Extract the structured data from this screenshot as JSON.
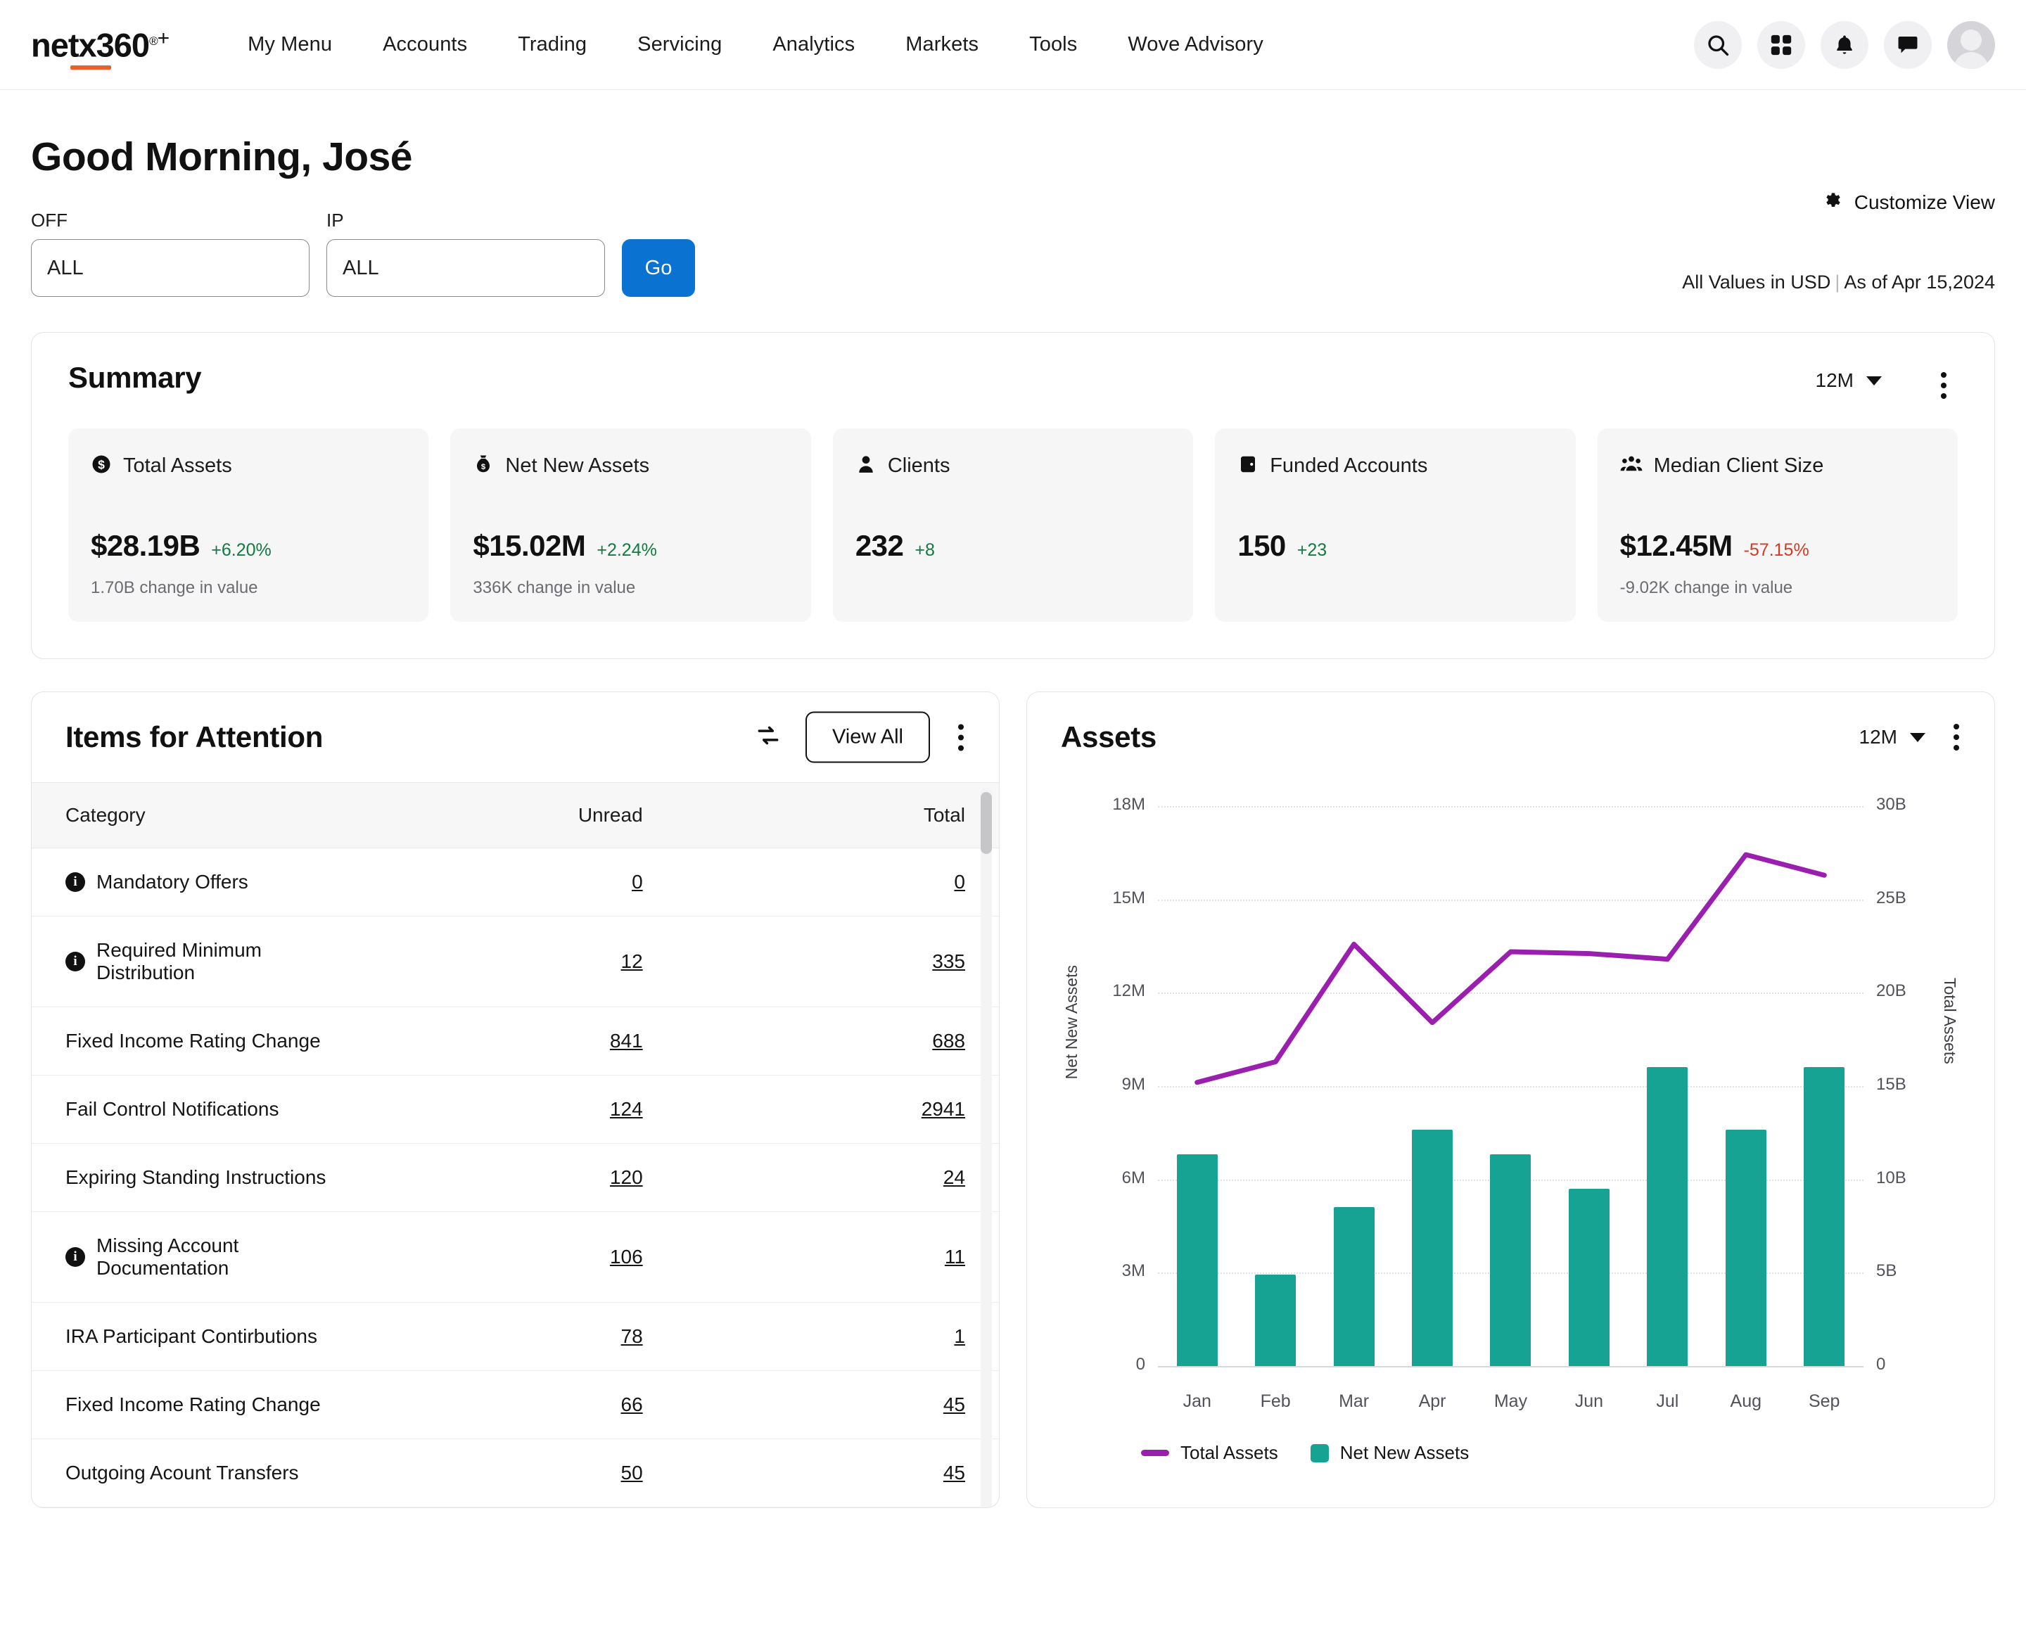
{
  "nav": {
    "logo": {
      "text": "netx360",
      "reg": "®",
      "plus": "+"
    },
    "links": [
      {
        "label": "My Menu"
      },
      {
        "label": "Accounts"
      },
      {
        "label": "Trading"
      },
      {
        "label": "Servicing"
      },
      {
        "label": "Analytics"
      },
      {
        "label": "Markets"
      },
      {
        "label": "Tools"
      },
      {
        "label": "Wove Advisory"
      }
    ],
    "actions": [
      "search-icon",
      "apps-grid-icon",
      "bell-icon",
      "chat-icon",
      "avatar"
    ]
  },
  "header": {
    "greeting": "Good Morning, José",
    "customize_label": "Customize View",
    "currency_note": "All Values in USD",
    "separator": "|",
    "as_of": "As of Apr 15,2024"
  },
  "filters": {
    "off": {
      "label": "OFF",
      "value": "ALL",
      "placeholder": "ALL"
    },
    "ip": {
      "label": "IP",
      "value": "ALL",
      "placeholder": "ALL"
    },
    "go_label": "Go"
  },
  "summary": {
    "title": "Summary",
    "range": "12M",
    "metrics": [
      {
        "icon": "dollar-coin-icon",
        "label": "Total Assets",
        "value": "$28.19B",
        "delta": "+6.20%",
        "delta_dir": "up",
        "sub": "1.70B change in value"
      },
      {
        "icon": "money-bag-icon",
        "label": "Net New Assets",
        "value": "$15.02M",
        "delta": "+2.24%",
        "delta_dir": "up",
        "sub": "336K change in value"
      },
      {
        "icon": "person-icon",
        "label": "Clients",
        "value": "232",
        "delta": "+8",
        "delta_dir": "up",
        "sub": ""
      },
      {
        "icon": "wallet-icon",
        "label": "Funded Accounts",
        "value": "150",
        "delta": "+23",
        "delta_dir": "up",
        "sub": ""
      },
      {
        "icon": "people-group-icon",
        "label": "Median Client Size",
        "value": "$12.45M",
        "delta": "-57.15%",
        "delta_dir": "down",
        "sub": "-9.02K change in value"
      }
    ]
  },
  "items_for_attention": {
    "title": "Items for Attention",
    "refresh_icon": "refresh-icon",
    "view_all_label": "View All",
    "columns": [
      "Category",
      "Unread",
      "Total"
    ],
    "rows": [
      {
        "info": true,
        "category": "Mandatory Offers",
        "unread": "0",
        "total": "0"
      },
      {
        "info": true,
        "category": "Required Minimum Distribution",
        "unread": "12",
        "total": "335"
      },
      {
        "info": false,
        "category": "Fixed Income Rating Change",
        "unread": "841",
        "total": "688"
      },
      {
        "info": false,
        "category": "Fail Control Notifications",
        "unread": "124",
        "total": "2941"
      },
      {
        "info": false,
        "category": "Expiring Standing Instructions",
        "unread": "120",
        "total": "24"
      },
      {
        "info": true,
        "category": "Missing Account Documentation",
        "unread": "106",
        "total": "11"
      },
      {
        "info": false,
        "category": "IRA Participant Contirbutions",
        "unread": "78",
        "total": "1"
      },
      {
        "info": false,
        "category": "Fixed Income Rating Change",
        "unread": "66",
        "total": "45"
      },
      {
        "info": false,
        "category": "Outgoing Acount Transfers",
        "unread": "50",
        "total": "45"
      }
    ]
  },
  "assets_panel": {
    "title": "Assets",
    "range": "12M"
  },
  "chart_data": {
    "type": "bar",
    "title": "Assets",
    "categories": [
      "Jan",
      "Feb",
      "Mar",
      "Apr",
      "May",
      "Jun",
      "Jul",
      "Aug",
      "Sep"
    ],
    "xlabel": "",
    "grid": true,
    "legend_position": "bottom-left",
    "series": [
      {
        "name": "Net New Assets",
        "type": "bar",
        "axis": "left",
        "color": "#16A394",
        "values": [
          6800000,
          2950000,
          5100000,
          7600000,
          6800000,
          5700000,
          9600000,
          7600000,
          9600000
        ]
      },
      {
        "name": "Total Assets",
        "type": "line",
        "axis": "right",
        "color": "#9A1FAF",
        "values": [
          15200000000,
          16300000000,
          22600000000,
          18400000000,
          22200000000,
          22100000000,
          21800000000,
          27400000000,
          26300000000
        ]
      }
    ],
    "left_axis": {
      "label": "Net New Assets",
      "ticks": [
        "0",
        "3M",
        "6M",
        "9M",
        "12M",
        "15M",
        "18M"
      ],
      "ylim": [
        0,
        18000000
      ]
    },
    "right_axis": {
      "label": "Total Assets",
      "ticks": [
        "0",
        "5B",
        "10B",
        "15B",
        "20B",
        "25B",
        "30B"
      ],
      "ylim": [
        0,
        30000000000
      ]
    },
    "legend": [
      "Total Assets",
      "Net New Assets"
    ]
  }
}
